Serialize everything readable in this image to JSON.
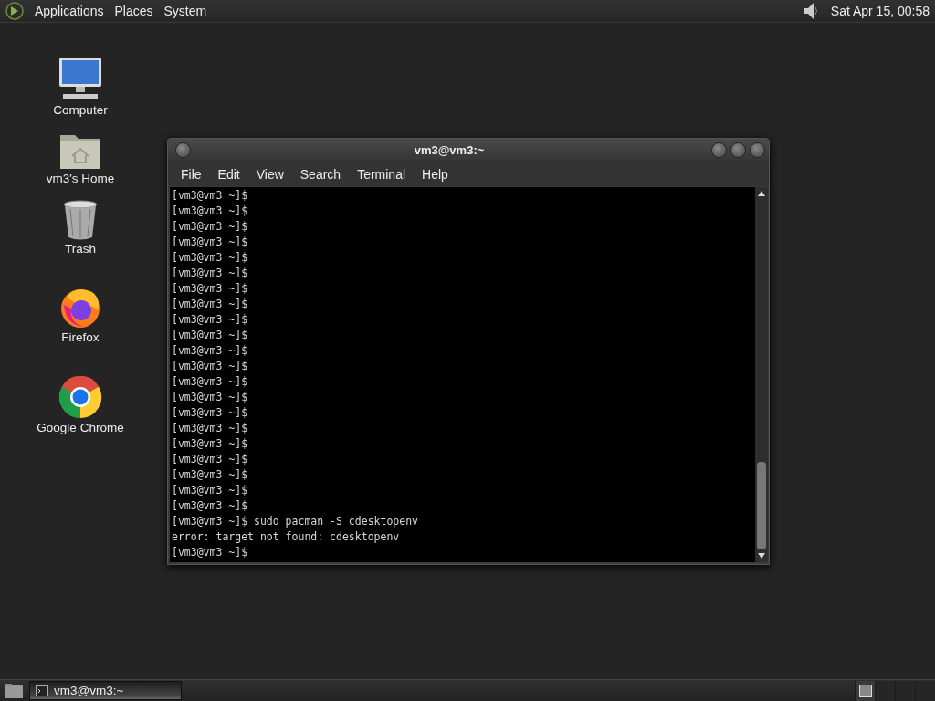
{
  "top_panel": {
    "menus": [
      "Applications",
      "Places",
      "System"
    ],
    "clock": "Sat Apr 15, 00:58"
  },
  "desktop_icons": [
    {
      "kind": "computer",
      "label": "Computer"
    },
    {
      "kind": "home",
      "label": "vm3's Home"
    },
    {
      "kind": "trash",
      "label": "Trash"
    },
    {
      "kind": "firefox",
      "label": "Firefox"
    },
    {
      "kind": "chrome",
      "label": "Google Chrome"
    }
  ],
  "terminal": {
    "title": "vm3@vm3:~",
    "menu": [
      "File",
      "Edit",
      "View",
      "Search",
      "Terminal",
      "Help"
    ],
    "lines": [
      "[vm3@vm3 ~]$",
      "[vm3@vm3 ~]$",
      "[vm3@vm3 ~]$",
      "[vm3@vm3 ~]$",
      "[vm3@vm3 ~]$",
      "[vm3@vm3 ~]$",
      "[vm3@vm3 ~]$",
      "[vm3@vm3 ~]$",
      "[vm3@vm3 ~]$",
      "[vm3@vm3 ~]$",
      "[vm3@vm3 ~]$",
      "[vm3@vm3 ~]$",
      "[vm3@vm3 ~]$",
      "[vm3@vm3 ~]$",
      "[vm3@vm3 ~]$",
      "[vm3@vm3 ~]$",
      "[vm3@vm3 ~]$",
      "[vm3@vm3 ~]$",
      "[vm3@vm3 ~]$",
      "[vm3@vm3 ~]$",
      "[vm3@vm3 ~]$",
      "[vm3@vm3 ~]$ sudo pacman -S cdesktopenv",
      "error: target not found: cdesktopenv",
      "[vm3@vm3 ~]$"
    ]
  },
  "taskbar": {
    "tasks": [
      {
        "label": "vm3@vm3:~",
        "selected": true
      }
    ],
    "workspaces": [
      {
        "selected": true
      },
      {
        "selected": false
      },
      {
        "selected": false
      },
      {
        "selected": false
      }
    ]
  }
}
